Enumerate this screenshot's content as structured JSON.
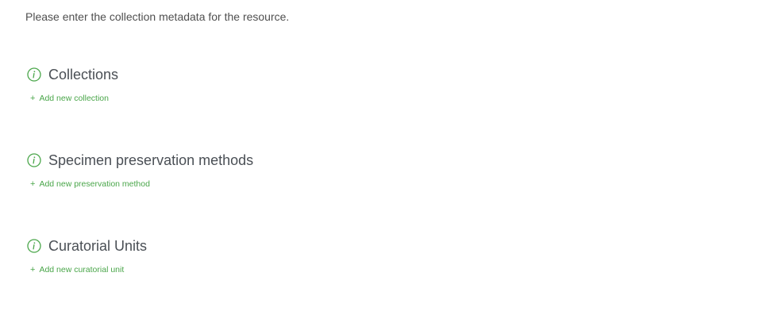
{
  "intro": {
    "text": "Please enter the collection metadata for the resource."
  },
  "sections": [
    {
      "title": "Collections",
      "add_label": "Add new collection",
      "icon": "info-icon"
    },
    {
      "title": "Specimen preservation methods",
      "add_label": "Add new preservation method",
      "icon": "info-icon"
    },
    {
      "title": "Curatorial Units",
      "add_label": "Add new curatorial unit",
      "icon": "info-icon"
    }
  ],
  "colors": {
    "accent_green": "#4aa64a",
    "heading_text": "#4a4f55",
    "body_text": "#4f4f4f"
  }
}
